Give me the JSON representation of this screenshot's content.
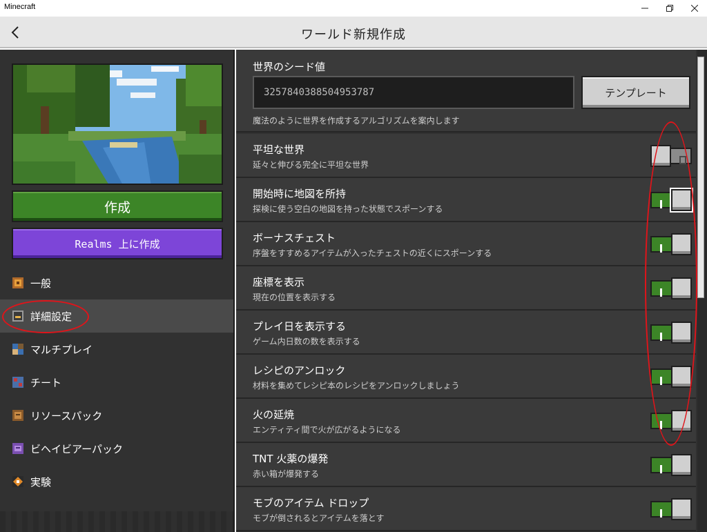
{
  "window": {
    "app_title": "Minecraft"
  },
  "header": {
    "title": "ワールド新規作成"
  },
  "left": {
    "create_label": "作成",
    "realms_label": "Realms 上に作成",
    "nav": [
      {
        "label": "一般",
        "icon": "general-icon"
      },
      {
        "label": "詳細設定",
        "icon": "advanced-icon",
        "active": true
      },
      {
        "label": "マルチプレイ",
        "icon": "multiplayer-icon"
      },
      {
        "label": "チート",
        "icon": "cheats-icon"
      },
      {
        "label": "リソースパック",
        "icon": "resource-pack-icon"
      },
      {
        "label": "ビヘイビアーパック",
        "icon": "behavior-pack-icon"
      },
      {
        "label": "実験",
        "icon": "experiments-icon"
      }
    ]
  },
  "seed": {
    "label": "世界のシード値",
    "value": "3257840388504953787",
    "template_label": "テンプレート",
    "description": "魔法のように世界を作成するアルゴリズムを案内します"
  },
  "settings": [
    {
      "title": "平坦な世界",
      "desc": "延々と伸びる完全に平坦な世界",
      "on": false
    },
    {
      "title": "開始時に地図を所持",
      "desc": "探検に使う空白の地図を持った状態でスポーンする",
      "on": true
    },
    {
      "title": "ボーナスチェスト",
      "desc": "序盤をすすめるアイテムが入ったチェストの近くにスポーンする",
      "on": true
    },
    {
      "title": "座標を表示",
      "desc": "現在の位置を表示する",
      "on": true
    },
    {
      "title": "プレイ日を表示する",
      "desc": "ゲーム内日数の数を表示する",
      "on": true
    },
    {
      "title": "レシピのアンロック",
      "desc": "材料を集めてレシピ本のレシピをアンロックしましょう",
      "on": true
    },
    {
      "title": "火の延焼",
      "desc": "エンティティ間で火が広がるようになる",
      "on": true
    },
    {
      "title": "TNT 火薬の爆発",
      "desc": "赤い箱が爆発する",
      "on": true
    },
    {
      "title": "モブのアイテム ドロップ",
      "desc": "モブが倒されるとアイテムを落とす",
      "on": true
    }
  ],
  "colors": {
    "accent_green": "#3c8527",
    "accent_purple": "#7d45d8",
    "annotation_red": "#e0141a"
  }
}
